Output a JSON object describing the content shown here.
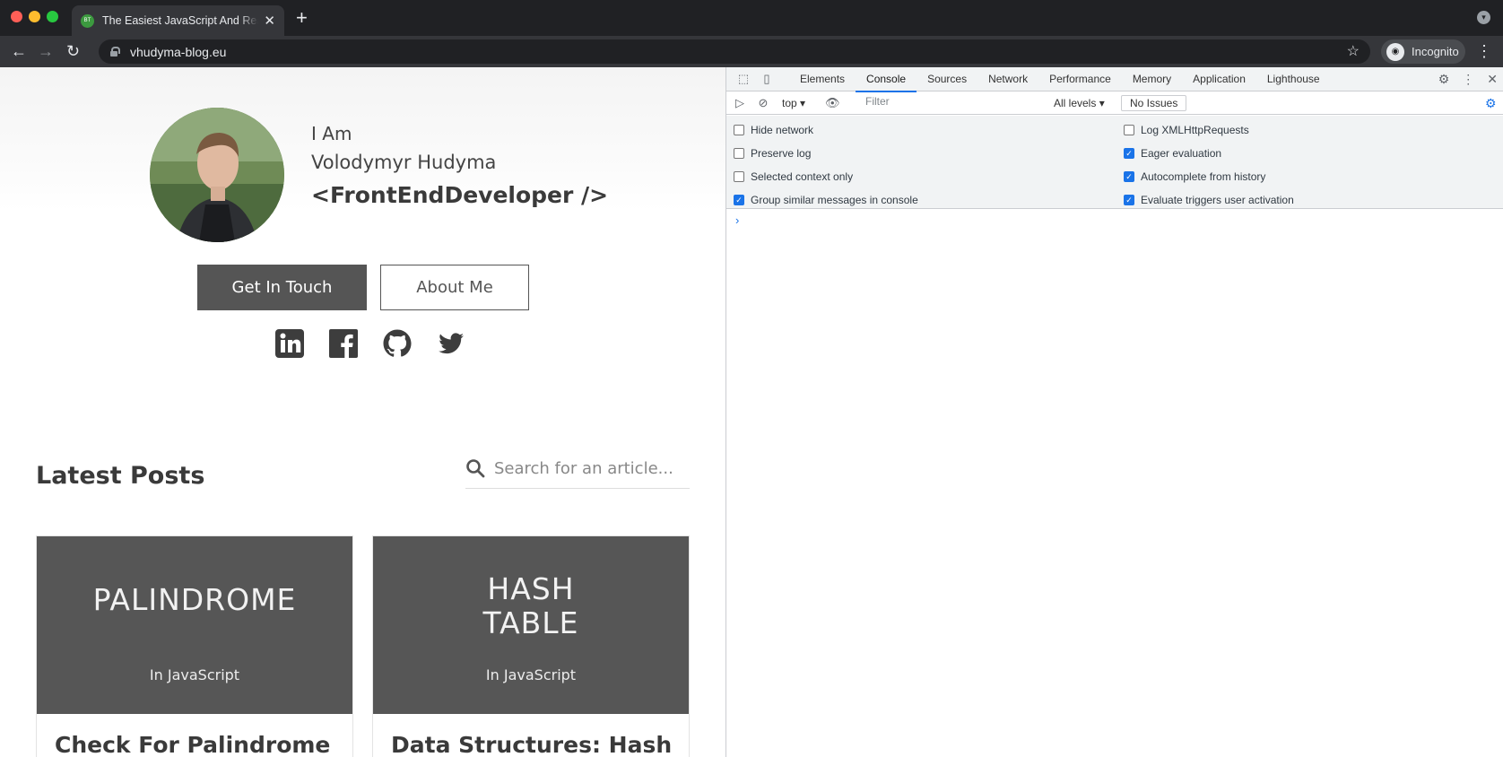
{
  "browser": {
    "tab": {
      "favicon_text": "BT",
      "title": "The Easiest JavaScript And React"
    },
    "url": "vhudyma-blog.eu",
    "profile_label": "Incognito"
  },
  "page": {
    "hero": {
      "intro": "I Am",
      "name": "Volodymyr Hudyma",
      "role": "<FrontEndDeveloper />",
      "primary_button": "Get In Touch",
      "secondary_button": "About Me"
    },
    "social": [
      "linkedin-icon",
      "facebook-icon",
      "github-icon",
      "twitter-icon"
    ],
    "posts": {
      "heading": "Latest Posts",
      "search_placeholder": "Search for an article...",
      "cards": [
        {
          "image_title": "PALINDROME",
          "image_subtitle": "In JavaScript",
          "title": "Check For Palindrome"
        },
        {
          "image_title": "HASH\nTABLE",
          "image_subtitle": "In JavaScript",
          "title": "Data Structures: Hash"
        }
      ]
    }
  },
  "devtools": {
    "tabs": [
      "Elements",
      "Console",
      "Sources",
      "Network",
      "Performance",
      "Memory",
      "Application",
      "Lighthouse"
    ],
    "active_tab": "Console",
    "context": "top",
    "filter_placeholder": "Filter",
    "levels": "All levels",
    "issues": "No Issues",
    "options_left": [
      {
        "label": "Hide network",
        "checked": false
      },
      {
        "label": "Preserve log",
        "checked": false
      },
      {
        "label": "Selected context only",
        "checked": false
      },
      {
        "label": "Group similar messages in console",
        "checked": true
      }
    ],
    "options_right": [
      {
        "label": "Log XMLHttpRequests",
        "checked": false
      },
      {
        "label": "Eager evaluation",
        "checked": true
      },
      {
        "label": "Autocomplete from history",
        "checked": true
      },
      {
        "label": "Evaluate triggers user activation",
        "checked": true
      }
    ],
    "prompt": "›"
  },
  "colors": {
    "accent": "#1a73e8",
    "button_dark": "#555555",
    "card_image": "#565656"
  }
}
